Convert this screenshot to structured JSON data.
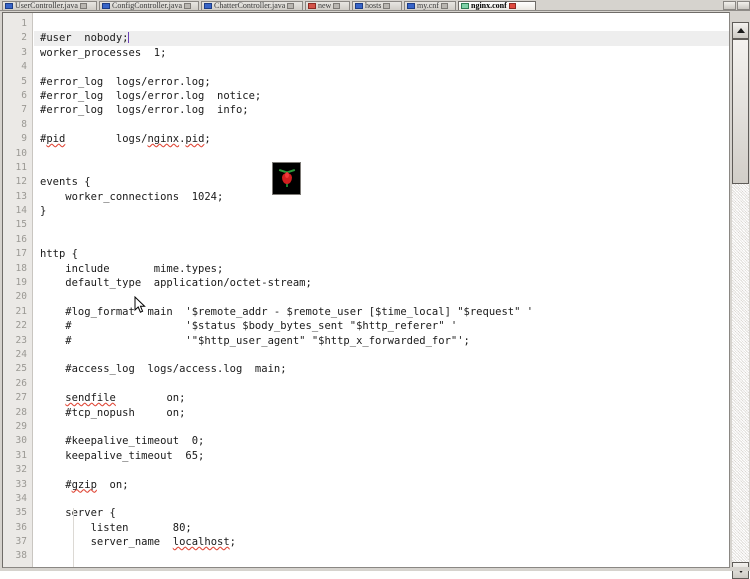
{
  "window": {
    "title": "nginx.conf",
    "app_kind": "text-editor"
  },
  "tabs": [
    {
      "label": "UserController.java",
      "icon": "java-file-icon",
      "active": false,
      "kind": "java"
    },
    {
      "label": "ConfigController.java",
      "icon": "java-file-icon",
      "active": false,
      "kind": "java"
    },
    {
      "label": "ChatterController.java",
      "icon": "java-file-icon",
      "active": false,
      "kind": "java"
    },
    {
      "label": "new",
      "icon": "new-file-icon",
      "active": false,
      "kind": "red"
    },
    {
      "label": "hosts",
      "icon": "text-file-icon",
      "active": false,
      "kind": "text"
    },
    {
      "label": "my.cnf",
      "icon": "text-file-icon",
      "active": false,
      "kind": "text"
    },
    {
      "label": "nginx.conf",
      "icon": "config-file-icon",
      "active": true,
      "kind": "green"
    }
  ],
  "tab_nav": {
    "prev_label": "◀",
    "next_label": "▶"
  },
  "editor": {
    "first_visible_line": 1,
    "last_visible_line": 38,
    "current_line": 2,
    "cursor_line": 2,
    "cursor_column": 15,
    "lines": [
      {
        "n": 1,
        "text": ""
      },
      {
        "n": 2,
        "text": "#user  nobody;"
      },
      {
        "n": 3,
        "text": "worker_processes  1;"
      },
      {
        "n": 4,
        "text": ""
      },
      {
        "n": 5,
        "text": "#error_log  logs/error.log;"
      },
      {
        "n": 6,
        "text": "#error_log  logs/error.log  notice;"
      },
      {
        "n": 7,
        "text": "#error_log  logs/error.log  info;"
      },
      {
        "n": 8,
        "text": ""
      },
      {
        "n": 9,
        "text": "#pid        logs/nginx.pid;"
      },
      {
        "n": 10,
        "text": ""
      },
      {
        "n": 11,
        "text": ""
      },
      {
        "n": 12,
        "text": "events {"
      },
      {
        "n": 13,
        "text": "    worker_connections  1024;"
      },
      {
        "n": 14,
        "text": "}"
      },
      {
        "n": 15,
        "text": ""
      },
      {
        "n": 16,
        "text": ""
      },
      {
        "n": 17,
        "text": "http {"
      },
      {
        "n": 18,
        "text": "    include       mime.types;"
      },
      {
        "n": 19,
        "text": "    default_type  application/octet-stream;"
      },
      {
        "n": 20,
        "text": ""
      },
      {
        "n": 21,
        "text": "    #log_format  main  '$remote_addr - $remote_user [$time_local] \"$request\" '"
      },
      {
        "n": 22,
        "text": "    #                  '$status $body_bytes_sent \"$http_referer\" '"
      },
      {
        "n": 23,
        "text": "    #                  '\"$http_user_agent\" \"$http_x_forwarded_for\"';"
      },
      {
        "n": 24,
        "text": ""
      },
      {
        "n": 25,
        "text": "    #access_log  logs/access.log  main;"
      },
      {
        "n": 26,
        "text": ""
      },
      {
        "n": 27,
        "text": "    sendfile        on;"
      },
      {
        "n": 28,
        "text": "    #tcp_nopush     on;"
      },
      {
        "n": 29,
        "text": ""
      },
      {
        "n": 30,
        "text": "    #keepalive_timeout  0;"
      },
      {
        "n": 31,
        "text": "    keepalive_timeout  65;"
      },
      {
        "n": 32,
        "text": ""
      },
      {
        "n": 33,
        "text": "    #gzip  on;"
      },
      {
        "n": 34,
        "text": ""
      },
      {
        "n": 35,
        "text": "    server {"
      },
      {
        "n": 36,
        "text": "        listen       80;"
      },
      {
        "n": 37,
        "text": "        server_name  localhost;"
      },
      {
        "n": 38,
        "text": ""
      }
    ]
  },
  "embedded_image": {
    "name": "red-tulip-thumbnail",
    "background": "#000000",
    "flower_color": "#d21f1f",
    "stem_color": "#1f7a2e"
  },
  "colors": {
    "window_chrome": "#d6d3ce",
    "editor_background": "#ffffff",
    "gutter_background": "#ebe9e6",
    "gutter_text": "#9a9893",
    "code_text": "#1a1a1a",
    "current_line_highlight": "#eeeeee",
    "caret": "#6a3fb5",
    "spellcheck_underline": "#e04a3a",
    "tab_active_accent": "#ffffff"
  },
  "scrollbar": {
    "orientation": "vertical",
    "up_arrow": "▲",
    "down_arrow": "▼",
    "thumb_position_percent": 0,
    "thumb_size_percent": 28
  }
}
